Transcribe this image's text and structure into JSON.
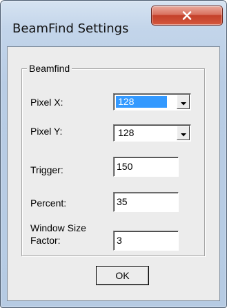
{
  "window": {
    "title": "BeamFind Settings"
  },
  "group": {
    "legend": "Beamfind"
  },
  "fields": {
    "pixel_x": {
      "label": "Pixel X:",
      "value": "128"
    },
    "pixel_y": {
      "label": "Pixel Y:",
      "value": "128"
    },
    "trigger": {
      "label": "Trigger:",
      "value": "150"
    },
    "percent": {
      "label": "Percent:",
      "value": "35"
    },
    "window_size_factor": {
      "label_line1": "Window Size",
      "label_line2": "Factor:",
      "value": "3"
    }
  },
  "buttons": {
    "ok_label": "OK"
  },
  "colors": {
    "selection": "#3399ff",
    "close_button": "#c4402a",
    "frame": "#b9cde5",
    "client": "#ececec"
  }
}
